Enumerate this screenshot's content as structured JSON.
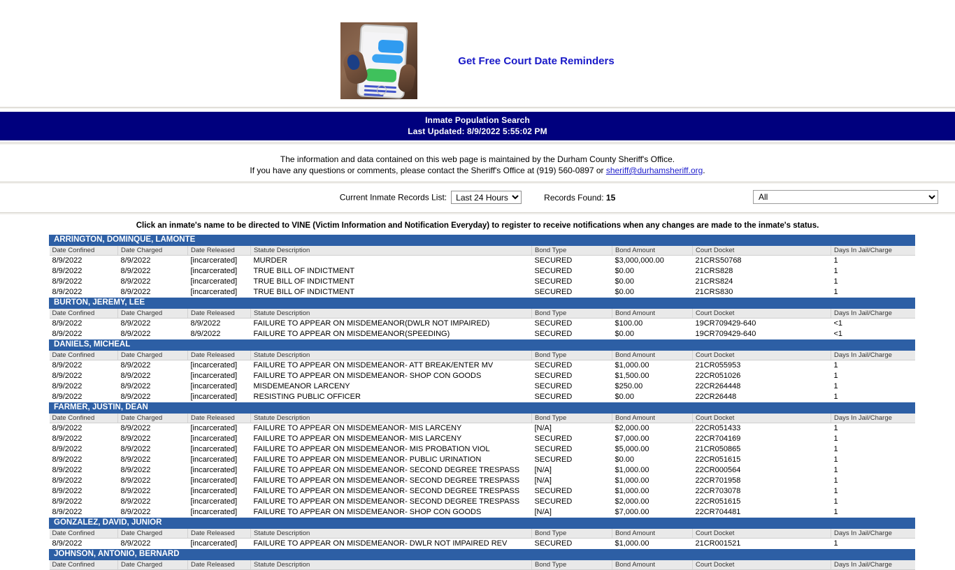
{
  "promo": {
    "link_text": "Get Free Court Date Reminders",
    "image_alt": "phone-text-message-photo"
  },
  "banner": {
    "title": "Inmate Population Search",
    "last_updated": "Last Updated: 8/9/2022 5:55:02 PM"
  },
  "info": {
    "line1": "The information and data contained on this web page is maintained by the Durham County Sheriff's Office.",
    "line2_pre": "If you have any questions or comments, please contact the Sheriff's Office at (919) 560-0897 or ",
    "email": "sheriff@durhamsheriff.org",
    "line2_post": "."
  },
  "controls": {
    "list_label": "Current Inmate Records List:",
    "range_selected": "Last 24 Hours",
    "range_options": [
      "Last 24 Hours"
    ],
    "records_found_label": "Records Found:",
    "records_found_count": "15",
    "filter_selected": "All",
    "filter_options": [
      "All"
    ]
  },
  "vine_note": "Click an inmate's name to be directed to VINE (Victim Information and Notification Everyday) to register to receive notifications when any changes are made to the inmate's status.",
  "columns": [
    "Date Confined",
    "Date Charged",
    "Date Released",
    "Statute Description",
    "Bond Type",
    "Bond Amount",
    "Court Docket",
    "Days In Jail/Charge"
  ],
  "inmates": [
    {
      "name": "ARRINGTON, DOMINQUE, LAMONTE",
      "charges": [
        [
          "8/9/2022",
          "8/9/2022",
          "[incarcerated]",
          "MURDER",
          "SECURED",
          "$3,000,000.00",
          "21CRS50768",
          "1"
        ],
        [
          "8/9/2022",
          "8/9/2022",
          "[incarcerated]",
          "TRUE BILL OF INDICTMENT",
          "SECURED",
          "$0.00",
          "21CRS828",
          "1"
        ],
        [
          "8/9/2022",
          "8/9/2022",
          "[incarcerated]",
          "TRUE BILL OF INDICTMENT",
          "SECURED",
          "$0.00",
          "21CRS824",
          "1"
        ],
        [
          "8/9/2022",
          "8/9/2022",
          "[incarcerated]",
          "TRUE BILL OF INDICTMENT",
          "SECURED",
          "$0.00",
          "21CRS830",
          "1"
        ]
      ]
    },
    {
      "name": "BURTON, JEREMY, LEE",
      "charges": [
        [
          "8/9/2022",
          "8/9/2022",
          "8/9/2022",
          "FAILURE TO APPEAR ON MISDEMEANOR(DWLR NOT IMPAIRED)",
          "SECURED",
          "$100.00",
          "19CR709429-640",
          "<1"
        ],
        [
          "8/9/2022",
          "8/9/2022",
          "8/9/2022",
          "FAILURE TO APPEAR ON MISDEMEANOR(SPEEDING)",
          "SECURED",
          "$0.00",
          "19CR709429-640",
          "<1"
        ]
      ]
    },
    {
      "name": "DANIELS, MICHEAL",
      "charges": [
        [
          "8/9/2022",
          "8/9/2022",
          "[incarcerated]",
          "FAILURE TO APPEAR ON MISDEMEANOR- ATT BREAK/ENTER MV",
          "SECURED",
          "$1,000.00",
          "21CR055953",
          "1"
        ],
        [
          "8/9/2022",
          "8/9/2022",
          "[incarcerated]",
          "FAILURE TO APPEAR ON MISDEMEANOR- SHOP CON GOODS",
          "SECURED",
          "$1,500.00",
          "22CR051026",
          "1"
        ],
        [
          "8/9/2022",
          "8/9/2022",
          "[incarcerated]",
          "MISDEMEANOR LARCENY",
          "SECURED",
          "$250.00",
          "22CR264448",
          "1"
        ],
        [
          "8/9/2022",
          "8/9/2022",
          "[incarcerated]",
          "RESISTING PUBLIC OFFICER",
          "SECURED",
          "$0.00",
          "22CR26448",
          "1"
        ]
      ]
    },
    {
      "name": "FARMER, JUSTIN, DEAN",
      "charges": [
        [
          "8/9/2022",
          "8/9/2022",
          "[incarcerated]",
          "FAILURE TO APPEAR ON MISDEMEANOR- MIS LARCENY",
          "[N/A]",
          "$2,000.00",
          "22CR051433",
          "1"
        ],
        [
          "8/9/2022",
          "8/9/2022",
          "[incarcerated]",
          "FAILURE TO APPEAR ON MISDEMEANOR- MIS LARCENY",
          "SECURED",
          "$7,000.00",
          "22CR704169",
          "1"
        ],
        [
          "8/9/2022",
          "8/9/2022",
          "[incarcerated]",
          "FAILURE TO APPEAR ON MISDEMEANOR- MIS PROBATION VIOL",
          "SECURED",
          "$5,000.00",
          "21CR050865",
          "1"
        ],
        [
          "8/9/2022",
          "8/9/2022",
          "[incarcerated]",
          "FAILURE TO APPEAR ON MISDEMEANOR- PUBLIC URINATION",
          "SECURED",
          "$0.00",
          "22CR051615",
          "1"
        ],
        [
          "8/9/2022",
          "8/9/2022",
          "[incarcerated]",
          "FAILURE TO APPEAR ON MISDEMEANOR- SECOND DEGREE TRESPASS",
          "[N/A]",
          "$1,000.00",
          "22CR000564",
          "1"
        ],
        [
          "8/9/2022",
          "8/9/2022",
          "[incarcerated]",
          "FAILURE TO APPEAR ON MISDEMEANOR- SECOND DEGREE TRESPASS",
          "[N/A]",
          "$1,000.00",
          "22CR701958",
          "1"
        ],
        [
          "8/9/2022",
          "8/9/2022",
          "[incarcerated]",
          "FAILURE TO APPEAR ON MISDEMEANOR- SECOND DEGREE TRESPASS",
          "SECURED",
          "$1,000.00",
          "22CR703078",
          "1"
        ],
        [
          "8/9/2022",
          "8/9/2022",
          "[incarcerated]",
          "FAILURE TO APPEAR ON MISDEMEANOR- SECOND DEGREE TRESPASS",
          "SECURED",
          "$2,000.00",
          "22CR051615",
          "1"
        ],
        [
          "8/9/2022",
          "8/9/2022",
          "[incarcerated]",
          "FAILURE TO APPEAR ON MISDEMEANOR- SHOP CON GOODS",
          "[N/A]",
          "$7,000.00",
          "22CR704481",
          "1"
        ]
      ]
    },
    {
      "name": "GONZALEZ, DAVID, JUNIOR",
      "charges": [
        [
          "8/9/2022",
          "8/9/2022",
          "[incarcerated]",
          "FAILURE TO APPEAR ON MISDEMEANOR- DWLR NOT IMPAIRED REV",
          "SECURED",
          "$1,000.00",
          "21CR001521",
          "1"
        ]
      ]
    },
    {
      "name": "JOHNSON, ANTONIO, BERNARD",
      "charges": []
    }
  ],
  "colors": {
    "banner_navy": "#00007e",
    "name_row_blue": "#2d5fa5",
    "header_gray": "#e9e9e9",
    "link_blue": "#1919c8"
  }
}
